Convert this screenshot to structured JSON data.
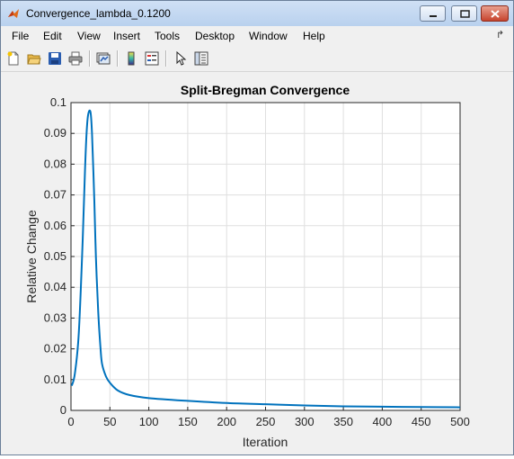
{
  "window": {
    "title": "Convergence_lambda_0.1200"
  },
  "menu": [
    "File",
    "Edit",
    "View",
    "Insert",
    "Tools",
    "Desktop",
    "Window",
    "Help"
  ],
  "menu_overflow_icon": "double-chevron-icon",
  "toolbar": [
    "new-figure-icon",
    "open-file-icon",
    "save-icon",
    "print-icon",
    "link-plot-icon",
    "insert-colorbar-icon",
    "insert-legend-icon",
    "pointer-edit-icon",
    "property-inspector-icon"
  ],
  "colors": {
    "line": "#0072bd",
    "grid": "#dfdfdf",
    "background": "#f0f0f0"
  },
  "chart_data": {
    "type": "line",
    "title": "Split-Bregman Convergence",
    "xlabel": "Iteration",
    "ylabel": "Relative Change",
    "xlim": [
      0,
      500
    ],
    "ylim": [
      0,
      0.1
    ],
    "xticks": [
      "0",
      "50",
      "100",
      "150",
      "200",
      "250",
      "300",
      "350",
      "400",
      "450",
      "500"
    ],
    "yticks": [
      "0",
      "0.01",
      "0.02",
      "0.03",
      "0.04",
      "0.05",
      "0.06",
      "0.07",
      "0.08",
      "0.09",
      "0.1"
    ],
    "grid": true,
    "series": [
      {
        "x": [
          1,
          5,
          10,
          15,
          18,
          20,
          22,
          25,
          27,
          30,
          32,
          35,
          38,
          40,
          45,
          50,
          60,
          75,
          100,
          150,
          200,
          250,
          300,
          350,
          400,
          450,
          500
        ],
        "y": [
          0.008,
          0.012,
          0.025,
          0.055,
          0.078,
          0.09,
          0.096,
          0.097,
          0.09,
          0.068,
          0.05,
          0.032,
          0.02,
          0.015,
          0.011,
          0.009,
          0.0065,
          0.005,
          0.004,
          0.0031,
          0.0024,
          0.002,
          0.0016,
          0.0013,
          0.0012,
          0.0011,
          0.001
        ]
      }
    ]
  }
}
